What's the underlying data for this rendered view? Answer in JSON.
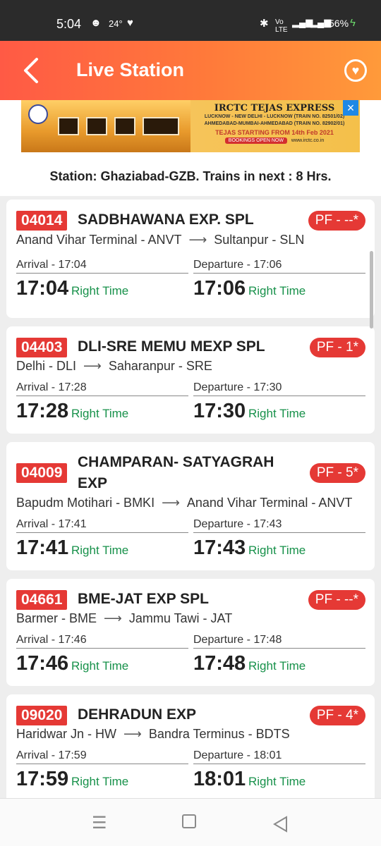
{
  "status_bar": {
    "time": "5:04",
    "weather": "24°",
    "battery": "56%",
    "icons": [
      "face-icon",
      "heart-icon",
      "bluetooth-icon",
      "volte-icon",
      "signal-icon",
      "signal-icon",
      "battery-charging-icon"
    ]
  },
  "app_bar": {
    "title": "Live Station",
    "back_icon": "chevron-left-icon",
    "favorite_icon": "heart-icon"
  },
  "ad": {
    "headline": "IRCTC TEJAS EXPRESS",
    "line1": "LUCKNOW - NEW DELHI - LUCKNOW (TRAIN NO. 82501/02)",
    "line2": "AHMEDABAD-MUMBAI-AHMEDABAD (TRAIN NO. 82902/01)",
    "line3": "TEJAS STARTING FROM 14th Feb 2021",
    "button": "BOOKINGS OPEN NOW",
    "url": "www.irctc.co.in",
    "close": "×"
  },
  "station_info": "Station: Ghaziabad-GZB. Trains in next : 8 Hrs.",
  "colors": {
    "accent": "#e53935",
    "on_time": "#17914a",
    "header_start": "#ff5a45",
    "header_end": "#ff9a3a"
  },
  "trains": [
    {
      "number": "04014",
      "name": "SADBHAWANA EXP. SPL",
      "platform": "PF - --*",
      "from": "Anand Vihar Terminal - ANVT",
      "to": "Sultanpur - SLN",
      "arrival_label": "Arrival -  17:04",
      "departure_label": "Departure -  17:06",
      "arrival": "17:04",
      "departure": "17:06",
      "arrival_status": "Right Time",
      "departure_status": "Right Time"
    },
    {
      "number": "04403",
      "name": "DLI-SRE MEMU MEXP SPL",
      "platform": "PF - 1*",
      "from": "Delhi - DLI",
      "to": "Saharanpur - SRE",
      "arrival_label": "Arrival -  17:28",
      "departure_label": "Departure -  17:30",
      "arrival": "17:28",
      "departure": "17:30",
      "arrival_status": "Right Time",
      "departure_status": "Right Time"
    },
    {
      "number": "04009",
      "name": "CHAMPARAN- SATYAGRAH EXP",
      "platform": "PF - 5*",
      "from": "Bapudm Motihari - BMKI",
      "to": "Anand Vihar Terminal - ANVT",
      "arrival_label": "Arrival -  17:41",
      "departure_label": "Departure -  17:43",
      "arrival": "17:41",
      "departure": "17:43",
      "arrival_status": "Right Time",
      "departure_status": "Right Time"
    },
    {
      "number": "04661",
      "name": "BME-JAT EXP SPL",
      "platform": "PF - --*",
      "from": "Barmer - BME",
      "to": "Jammu Tawi - JAT",
      "arrival_label": "Arrival -  17:46",
      "departure_label": "Departure -  17:48",
      "arrival": "17:46",
      "departure": "17:48",
      "arrival_status": "Right Time",
      "departure_status": "Right Time"
    },
    {
      "number": "09020",
      "name": "DEHRADUN EXP",
      "platform": "PF - 4*",
      "from": "Haridwar Jn - HW",
      "to": "Bandra Terminus - BDTS",
      "arrival_label": "Arrival -  17:59",
      "departure_label": "Departure -  18:01",
      "arrival": "17:59",
      "departure": "18:01",
      "arrival_status": "Right Time",
      "departure_status": "Right Time"
    }
  ],
  "nav_bar": {
    "icons": [
      "menu-icon",
      "home-square-icon",
      "back-triangle-icon"
    ]
  }
}
